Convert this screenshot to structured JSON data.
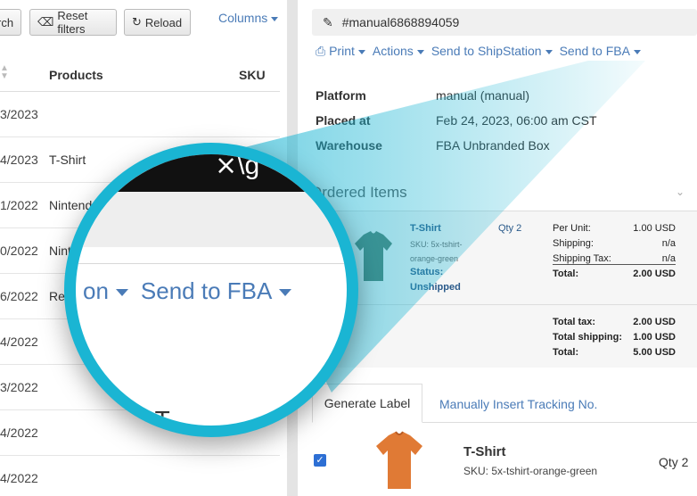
{
  "toolbar": {
    "search_partial": "rch",
    "reset_label": "Reset filters",
    "reload_label": "Reload",
    "columns_label": "Columns"
  },
  "table": {
    "headers": {
      "products": "Products",
      "sku": "SKU"
    },
    "rows": [
      {
        "date": "3/2023",
        "product": ""
      },
      {
        "date": "4/2023",
        "product": "T-Shirt"
      },
      {
        "date": "1/2022",
        "product": "Nintend"
      },
      {
        "date": "0/2022",
        "product": "Nint"
      },
      {
        "date": "6/2022",
        "product": "Re"
      },
      {
        "date": "4/2022",
        "product": ""
      },
      {
        "date": "3/2022",
        "product": ""
      },
      {
        "date": "4/2022",
        "product": ""
      },
      {
        "date": "4/2022",
        "product": ""
      }
    ]
  },
  "order": {
    "number": "#manual6868894059",
    "actions": {
      "print": "Print",
      "actions": "Actions",
      "shipstation": "Send to ShipStation",
      "fba": "Send to FBA"
    },
    "info": [
      {
        "label": "Platform",
        "value": "manual (manual)"
      },
      {
        "label": "Placed at",
        "value": "Feb 24, 2023, 06:00 am CST"
      },
      {
        "label": "Warehouse",
        "value": "FBA Unbranded Box"
      }
    ],
    "ordered_items_title": "Ordered Items",
    "item": {
      "name": "T-Shirt",
      "sku": "SKU: 5x-tshirt-orange-green",
      "status_label": "Status:",
      "status_value": "Unshipped",
      "qty": "Qty 2",
      "pricing": [
        {
          "label": "Per Unit:",
          "value": "1.00 USD"
        },
        {
          "label": "Shipping:",
          "value": "n/a"
        },
        {
          "label": "Shipping Tax:",
          "value": "n/a"
        },
        {
          "label": "Total:",
          "value": "2.00 USD"
        }
      ]
    },
    "totals": [
      {
        "label": "Total tax:",
        "value": "2.00 USD"
      },
      {
        "label": "Total shipping:",
        "value": "1.00 USD"
      },
      {
        "label": "Total:",
        "value": "5.00 USD"
      }
    ],
    "tabs": {
      "generate": "Generate Label",
      "manual": "Manually Insert Tracking No."
    },
    "label_item": {
      "name": "T-Shirt",
      "sku": "SKU: 5x-tshirt-orange-green",
      "qty": "Qty 2",
      "checked": true
    }
  },
  "magnifier": {
    "text_partial": "on",
    "text_fba": "Send to FBA",
    "top_glyph": "⨯\\g",
    "bottom_partial": "ST"
  },
  "colors": {
    "link": "#4a7bb7",
    "accent": "#1ab5d3",
    "item_blue": "#2a5a8a",
    "shirt_green": "#4f7a68",
    "shirt_orange": "#e07a35"
  }
}
